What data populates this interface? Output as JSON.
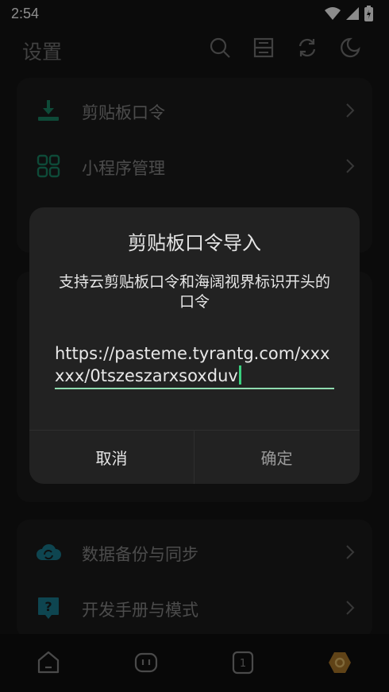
{
  "status": {
    "time": "2:54"
  },
  "header": {
    "title": "设置"
  },
  "card1": {
    "items": [
      {
        "label": "剪贴板口令",
        "icon": "download-icon"
      },
      {
        "label": "小程序管理",
        "icon": "apps-grid-icon"
      }
    ]
  },
  "card3": {
    "items": [
      {
        "label": "数据备份与同步",
        "icon": "cloud-sync-icon"
      },
      {
        "label": "开发手册与模式",
        "icon": "help-icon"
      }
    ]
  },
  "dialog": {
    "title": "剪贴板口令导入",
    "message": "支持云剪贴板口令和海阔视界标识开头的口令",
    "input_value": "https://pasteme.tyrantg.com/xxxxxx/0tszeszarxsoxduv",
    "cancel_label": "取消",
    "ok_label": "确定"
  },
  "colors": {
    "accent": "#1aa37a",
    "underline": "#8fdcb0",
    "nav_hex": "#b07a2a"
  }
}
